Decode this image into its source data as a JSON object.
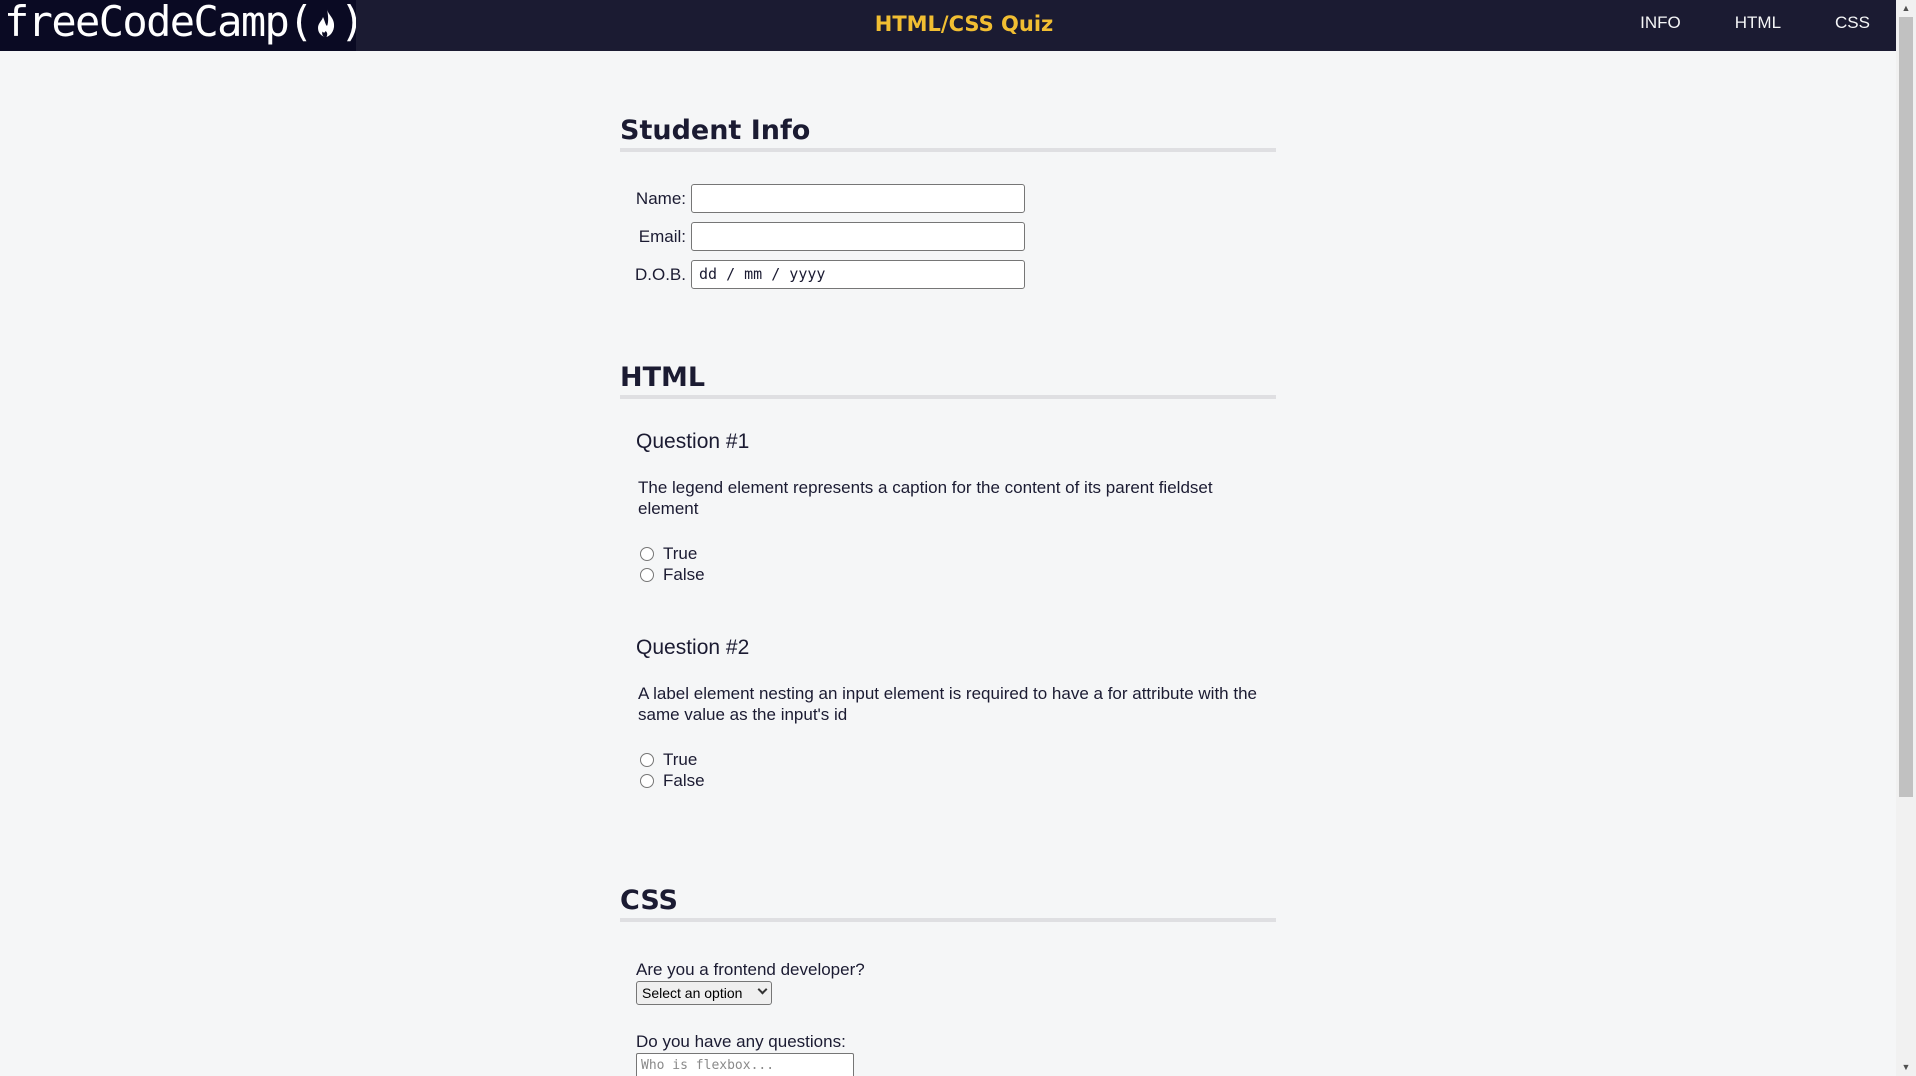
{
  "header": {
    "logo_text": "freeCodeCamp(",
    "logo_suffix": ")",
    "title": "HTML/CSS Quiz",
    "nav": [
      "INFO",
      "HTML",
      "CSS"
    ]
  },
  "student_info": {
    "heading": "Student Info",
    "name_label": "Name:",
    "email_label": "Email:",
    "dob_label": "D.O.B.",
    "dob_placeholder": "dd / mm / yyyy"
  },
  "html_section": {
    "heading": "HTML",
    "questions": [
      {
        "title": "Question #1",
        "text": "The legend element represents a caption for the content of its parent fieldset element",
        "options": [
          "True",
          "False"
        ]
      },
      {
        "title": "Question #2",
        "text": "A label element nesting an input element is required to have a for attribute with the same value as the input's id",
        "options": [
          "True",
          "False"
        ]
      }
    ]
  },
  "css_section": {
    "heading": "CSS",
    "frontend_label": "Are you a frontend developer?",
    "select_value": "Select an option",
    "questions_label": "Do you have any questions:",
    "textarea_placeholder": "Who is flexbox..."
  }
}
